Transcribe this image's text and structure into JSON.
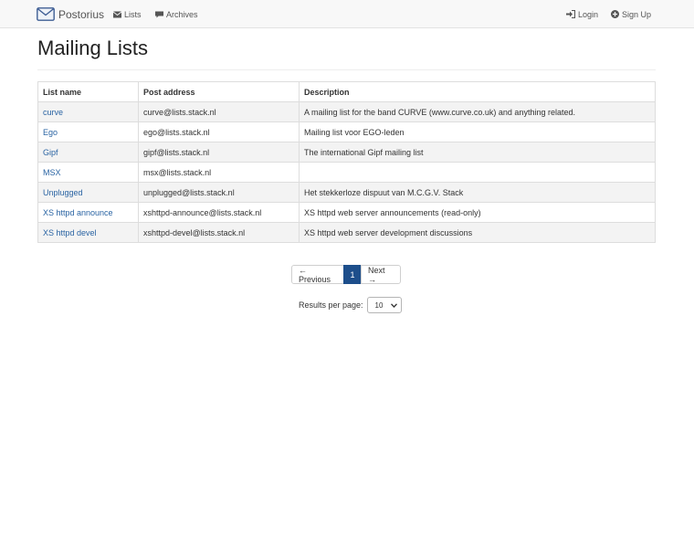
{
  "navbar": {
    "brand": "Postorius",
    "lists_label": "Lists",
    "archives_label": "Archives",
    "login_label": "Login",
    "signup_label": "Sign Up"
  },
  "page_title": "Mailing Lists",
  "table": {
    "headers": [
      "List name",
      "Post address",
      "Description"
    ],
    "rows": [
      {
        "name": "curve",
        "address": "curve@lists.stack.nl",
        "description": "A mailing list for the band CURVE (www.curve.co.uk) and anything related."
      },
      {
        "name": "Ego",
        "address": "ego@lists.stack.nl",
        "description": "Mailing list voor EGO-leden"
      },
      {
        "name": "Gipf",
        "address": "gipf@lists.stack.nl",
        "description": "The international Gipf mailing list"
      },
      {
        "name": "MSX",
        "address": "msx@lists.stack.nl",
        "description": ""
      },
      {
        "name": "Unplugged",
        "address": "unplugged@lists.stack.nl",
        "description": "Het stekkerloze dispuut van M.C.G.V. Stack"
      },
      {
        "name": "XS httpd announce",
        "address": "xshttpd-announce@lists.stack.nl",
        "description": "XS httpd web server announcements (read-only)"
      },
      {
        "name": "XS httpd devel",
        "address": "xshttpd-devel@lists.stack.nl",
        "description": "XS httpd web server development discussions"
      }
    ]
  },
  "pagination": {
    "previous": "← Previous",
    "current": "1",
    "next": "Next →"
  },
  "per_page": {
    "label": "Results per page:",
    "value": "10"
  },
  "colors": {
    "link": "#2a64a3",
    "active_page": "#1d4e8b",
    "navbar_bg": "#f8f8f8"
  }
}
